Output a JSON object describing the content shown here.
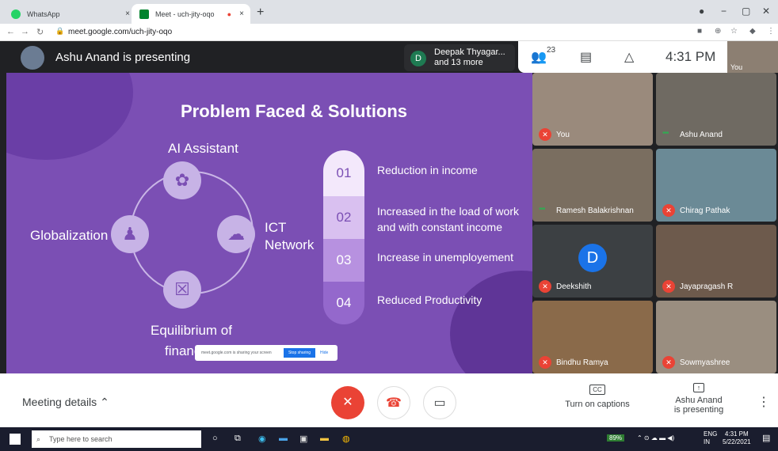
{
  "browser": {
    "tabs": [
      {
        "title": "WhatsApp",
        "close": "×"
      },
      {
        "title": "Meet - uch-jity-oqo",
        "close": "×"
      }
    ],
    "newtab": "+",
    "url": "meet.google.com/uch-jity-oqo",
    "window": {
      "minimize": "−",
      "maximize": "▢",
      "close": "✕"
    }
  },
  "meet": {
    "presenter_title": "Ashu Anand is presenting",
    "chip": {
      "initial": "D",
      "line1": "Deepak Thyagar...",
      "line2": "and 13 more"
    },
    "participant_count": "23",
    "time": "4:31 PM",
    "self_label": "You",
    "slide": {
      "title": "Problem Faced & Solutions",
      "labels": [
        "AI Assistant",
        "Globalization",
        "ICT",
        "Network",
        "Equilibrium of",
        "financ"
      ],
      "numbers": [
        "01",
        "02",
        "03",
        "04"
      ],
      "items": [
        "Reduction in income",
        "Increased in the load of work",
        "and with constant income",
        "Increase in unemployement",
        "Reduced Productivity"
      ],
      "share": {
        "text": "meet.google.com is sharing your screen",
        "stop": "Stop sharing",
        "hide": "Hide"
      }
    },
    "participants": [
      {
        "name": "You",
        "muted": true
      },
      {
        "name": "Ashu Anand",
        "muted": false
      },
      {
        "name": "Ramesh Balakrishnan",
        "muted": false
      },
      {
        "name": "Chirag Pathak",
        "muted": true
      },
      {
        "name": "Deekshith",
        "muted": true,
        "initial": "D"
      },
      {
        "name": "Jayapragash R",
        "muted": true
      },
      {
        "name": "Bindhu Ramya",
        "muted": true
      },
      {
        "name": "Sowmyashree",
        "muted": true
      }
    ],
    "bottom": {
      "meeting_details": "Meeting details",
      "captions": "Turn on captions",
      "cc": "CC",
      "presenting_line1": "Ashu Anand",
      "presenting_line2": "is presenting"
    }
  },
  "taskbar": {
    "search_placeholder": "Type here to search",
    "battery": "89%",
    "lang1": "ENG",
    "lang2": "IN",
    "clock_time": "4:31 PM",
    "clock_date": "5/22/2021"
  }
}
